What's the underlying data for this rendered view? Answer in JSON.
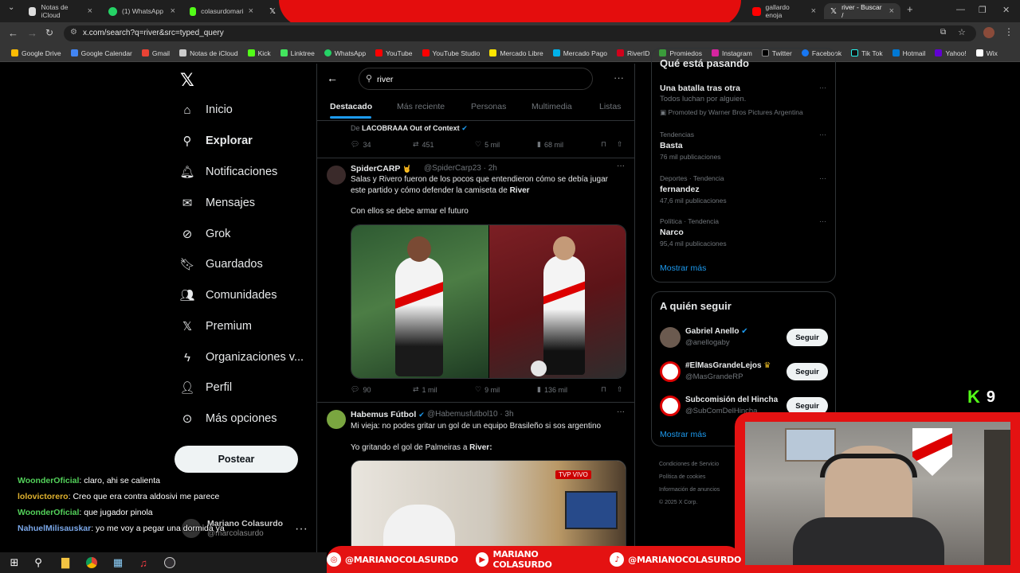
{
  "browser": {
    "tabs": [
      {
        "label": "Notas de iCloud"
      },
      {
        "label": "(1) WhatsApp"
      },
      {
        "label": "colasurdomari"
      },
      {
        "label": "gallardo enoja"
      },
      {
        "label": "river - Buscar /"
      }
    ],
    "url": "x.com/search?q=river&src=typed_query",
    "bookmarks": [
      "Google Drive",
      "Google Calendar",
      "Gmail",
      "Notas de iCloud",
      "Kick",
      "Linktree",
      "WhatsApp",
      "YouTube",
      "YouTube Studio",
      "Mercado Libre",
      "Mercado Pago",
      "RiverID",
      "Promiedos",
      "Instagram",
      "Twitter",
      "Facebook",
      "Tik Tok",
      "Hotmail",
      "Yahoo!",
      "Wix"
    ]
  },
  "colors": {
    "accent": "#1d9bf0",
    "overlay_red": "#e41212",
    "kick_green": "#53fc18"
  },
  "nav": {
    "items": [
      "Inicio",
      "Explorar",
      "Notificaciones",
      "Mensajes",
      "Grok",
      "Guardados",
      "Comunidades",
      "Premium",
      "Organizaciones v...",
      "Perfil",
      "Más opciones"
    ],
    "post_label": "Postear",
    "profile_name": "Mariano Colasurdo",
    "profile_handle": "@marcolasurdo"
  },
  "search": {
    "query": "river",
    "tabs": [
      "Destacado",
      "Más reciente",
      "Personas",
      "Multimedia",
      "Listas"
    ]
  },
  "tweets": [
    {
      "context_prefix": "De",
      "context_source": "LACOBRAAA Out of Context",
      "replies": "34",
      "reposts": "451",
      "likes": "5 mil",
      "views": "68 mil"
    },
    {
      "name": "SpiderCARP",
      "handle": "@SpiderCarp23",
      "time": "· 2h",
      "text_1": "Salas y Rivero fueron de los pocos que entendieron cómo se debía jugar este partido y cómo defender la camiseta de ",
      "text_1_bold": "River",
      "text_2": "Con ellos se debe armar el futuro",
      "replies": "90",
      "reposts": "1 mil",
      "likes": "9 mil",
      "views": "136 mil"
    },
    {
      "name": "Habemus Fútbol",
      "handle": "@Habemusfutbol10",
      "time": "· 3h",
      "text_1": "Mi vieja: no podes gritar un gol de un equipo Brasileño si sos argentino",
      "text_2": "Yo gritando el gol de Palmeiras a ",
      "text_2_bold": "River",
      "text_2_end": ":",
      "media_badge": "TVP VIVO"
    }
  ],
  "trends": {
    "header": "Qué está pasando",
    "promo": {
      "title": "Una batalla tras otra",
      "subtitle": "Todos luchan por alguien.",
      "promoted": "Promoted by Warner Bros Pictures Argentina"
    },
    "items": [
      {
        "meta": "Tendencias",
        "title": "Basta",
        "count": "76 mil publicaciones"
      },
      {
        "meta": "Deportes · Tendencia",
        "title": "fernandez",
        "count": "47,6 mil publicaciones"
      },
      {
        "meta": "Política · Tendencia",
        "title": "Narco",
        "count": "95,4 mil publicaciones"
      }
    ],
    "show_more": "Mostrar más"
  },
  "who_to_follow": {
    "header": "A quién seguir",
    "items": [
      {
        "name": "Gabriel Anello",
        "handle": "@anellogaby",
        "button": "Seguir"
      },
      {
        "name": "#ElMasGrandeLejos",
        "handle": "@MasGrandeRP",
        "button": "Seguir"
      },
      {
        "name": "Subcomisión del Hincha",
        "handle": "@SubComDelHincha",
        "button": "Seguir"
      }
    ],
    "show_more": "Mostrar más"
  },
  "footer": [
    "Condiciones de Servicio",
    "Política de cookies",
    "Información de anuncios",
    "© 2025 X Corp."
  ],
  "chat": [
    {
      "user": "WoonderOficial",
      "msg": ": claro, ahi se calienta",
      "color": "#53d15a"
    },
    {
      "user": "lolovictorero",
      "msg": ": Creo que era contra aldosivi me parece",
      "color": "#e0b22e"
    },
    {
      "user": "WoonderOficial",
      "msg": ": que jugador pinola",
      "color": "#53d15a"
    },
    {
      "user": "NahuelMilisauskar",
      "msg": ": yo me voy a pegar una dormida ya",
      "color": "#7aa7e8"
    }
  ],
  "kick_viewers": "9",
  "socials": [
    "@MARIANOCOLASURDO",
    "MARIANO COLASURDO",
    "@MARIANOCOLASURDO"
  ]
}
